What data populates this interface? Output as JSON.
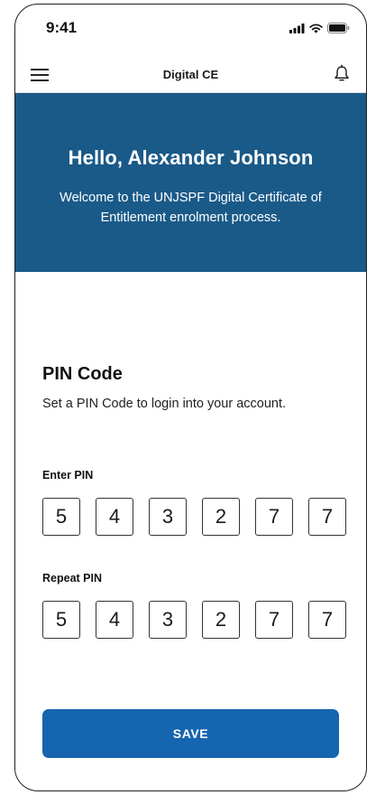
{
  "status_bar": {
    "time": "9:41"
  },
  "header": {
    "title": "Digital CE",
    "menu_icon": "hamburger-menu-icon",
    "bell_icon": "bell-icon"
  },
  "hero": {
    "greeting": "Hello, Alexander Johnson",
    "message": "Welcome to the UNJSPF Digital Certificate of Entitlement enrolment process.",
    "background_color": "#1a5a88"
  },
  "pin_section": {
    "title": "PIN Code",
    "subtitle": "Set a PIN Code to login into your account.",
    "enter_label": "Enter PIN",
    "enter_digits": [
      "5",
      "4",
      "3",
      "2",
      "7",
      "7"
    ],
    "repeat_label": "Repeat PIN",
    "repeat_digits": [
      "5",
      "4",
      "3",
      "2",
      "7",
      "7"
    ]
  },
  "actions": {
    "save_label": "SAVE",
    "save_color": "#1565b0"
  }
}
